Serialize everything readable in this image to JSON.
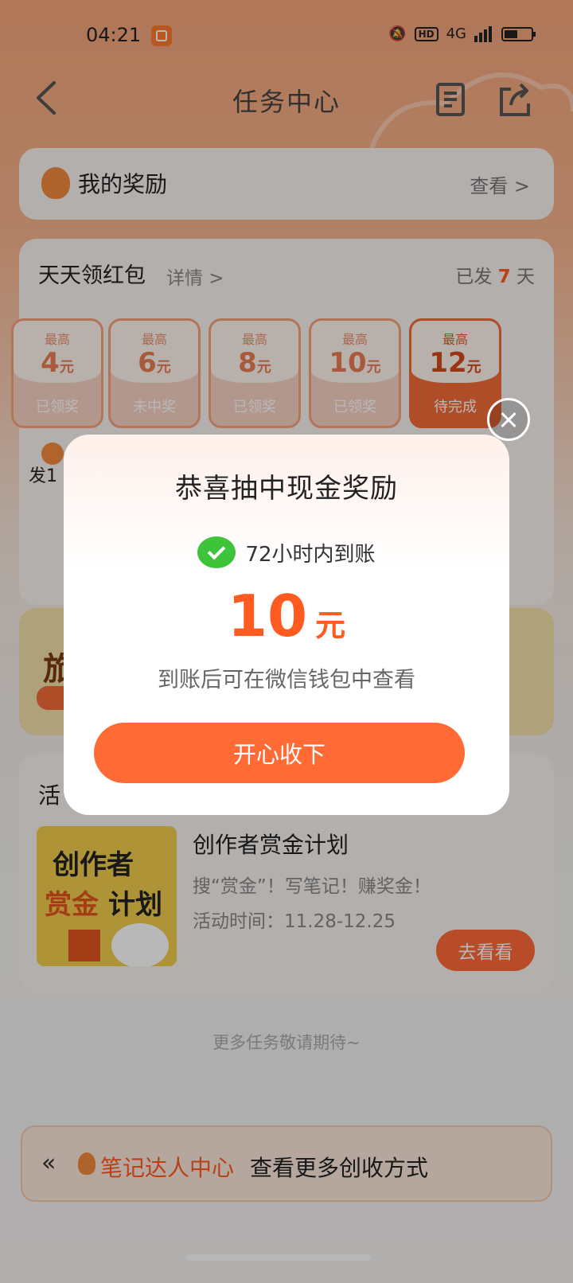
{
  "status_bar": {
    "time": "04:21",
    "hd": "HD",
    "network": "4G"
  },
  "nav": {
    "title": "任务中心"
  },
  "reward_card": {
    "title": "我的奖励",
    "link": "查看 >"
  },
  "daily": {
    "title": "天天领红包",
    "detail": "详情 >",
    "count_prefix": "已发",
    "count_value": "7",
    "count_suffix": "天",
    "days": [
      {
        "max": "最高",
        "amount": "4",
        "unit": "元",
        "status": "已领奖"
      },
      {
        "max": "最高",
        "amount": "6",
        "unit": "元",
        "status": "未中奖"
      },
      {
        "max": "最高",
        "amount": "8",
        "unit": "元",
        "status": "已领奖"
      },
      {
        "max": "最高",
        "amount": "10",
        "unit": "元",
        "status": "已领奖"
      },
      {
        "max": "最高",
        "amount": "12",
        "unit": "元",
        "status": "待完成"
      }
    ],
    "fragment": "发1"
  },
  "banner": {
    "text": "旅"
  },
  "activity": {
    "heading": "活",
    "title": "创作者赏金计划",
    "desc": "搜“赏金”！写笔记！赚奖金！",
    "time": "活动时间：11.28-12.25",
    "button": "去看看"
  },
  "more": "更多任务敬请期待~",
  "bottom": {
    "highlight": "笔记达人中心",
    "text": "查看更多创收方式"
  },
  "modal": {
    "title": "恭喜抽中现金奖励",
    "subtitle": "72小时内到账",
    "amount": "10",
    "unit": "元",
    "note": "到账后可在微信钱包中查看",
    "button": "开心收下"
  },
  "colors": {
    "accent": "#ff6a35",
    "wechat": "#3ec43a"
  }
}
